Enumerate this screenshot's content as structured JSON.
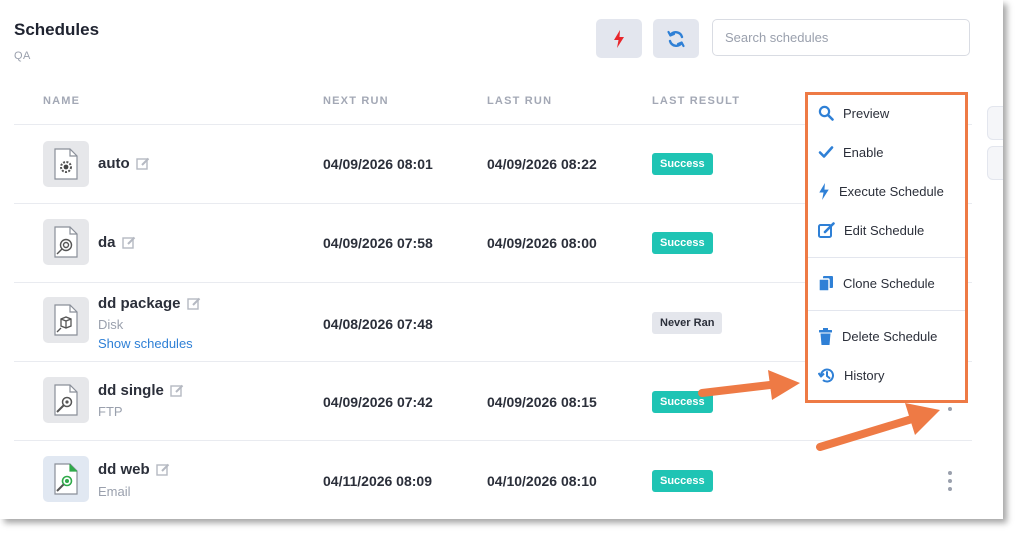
{
  "header": {
    "title": "Schedules",
    "subtitle": "QA",
    "execute_icon": "lightning-icon",
    "refresh_icon": "refresh-icon",
    "search_placeholder": "Search schedules"
  },
  "table": {
    "columns": [
      "NAME",
      "NEXT RUN",
      "LAST RUN",
      "LAST RESULT"
    ],
    "rows": [
      {
        "name": "auto",
        "sub": "",
        "link": "",
        "next_run": "04/09/2026 08:01",
        "last_run": "04/09/2026 08:22",
        "result": "Success",
        "icon": "settings-file-icon"
      },
      {
        "name": "da",
        "sub": "",
        "link": "",
        "next_run": "04/09/2026 07:58",
        "last_run": "04/09/2026 08:00",
        "result": "Success",
        "icon": "target-file-icon"
      },
      {
        "name": "dd package",
        "sub": "Disk",
        "link": "Show schedules",
        "next_run": "04/08/2026 07:48",
        "last_run": "",
        "result": "Never Ran",
        "icon": "package-file-icon"
      },
      {
        "name": "dd single",
        "sub": "FTP",
        "link": "",
        "next_run": "04/09/2026 07:42",
        "last_run": "04/09/2026 08:15",
        "result": "Success",
        "icon": "search-file-icon"
      },
      {
        "name": "dd web",
        "sub": "Email",
        "link": "",
        "next_run": "04/11/2026 08:09",
        "last_run": "04/10/2026 08:10",
        "result": "Success",
        "icon": "web-file-icon"
      }
    ]
  },
  "menu": {
    "items": [
      {
        "label": "Preview",
        "icon": "search-icon"
      },
      {
        "label": "Enable",
        "icon": "check-icon"
      },
      {
        "label": "Execute Schedule",
        "icon": "lightning-icon"
      },
      {
        "label": "Edit Schedule",
        "icon": "edit-icon"
      },
      {
        "label": "Clone Schedule",
        "icon": "copy-icon"
      },
      {
        "label": "Delete Schedule",
        "icon": "trash-icon"
      },
      {
        "label": "History",
        "icon": "history-icon"
      }
    ]
  },
  "colors": {
    "accent_blue": "#2f80d6",
    "success": "#1fc4b4",
    "execute_red": "#e8262b",
    "highlight_orange": "#ee7a45"
  }
}
